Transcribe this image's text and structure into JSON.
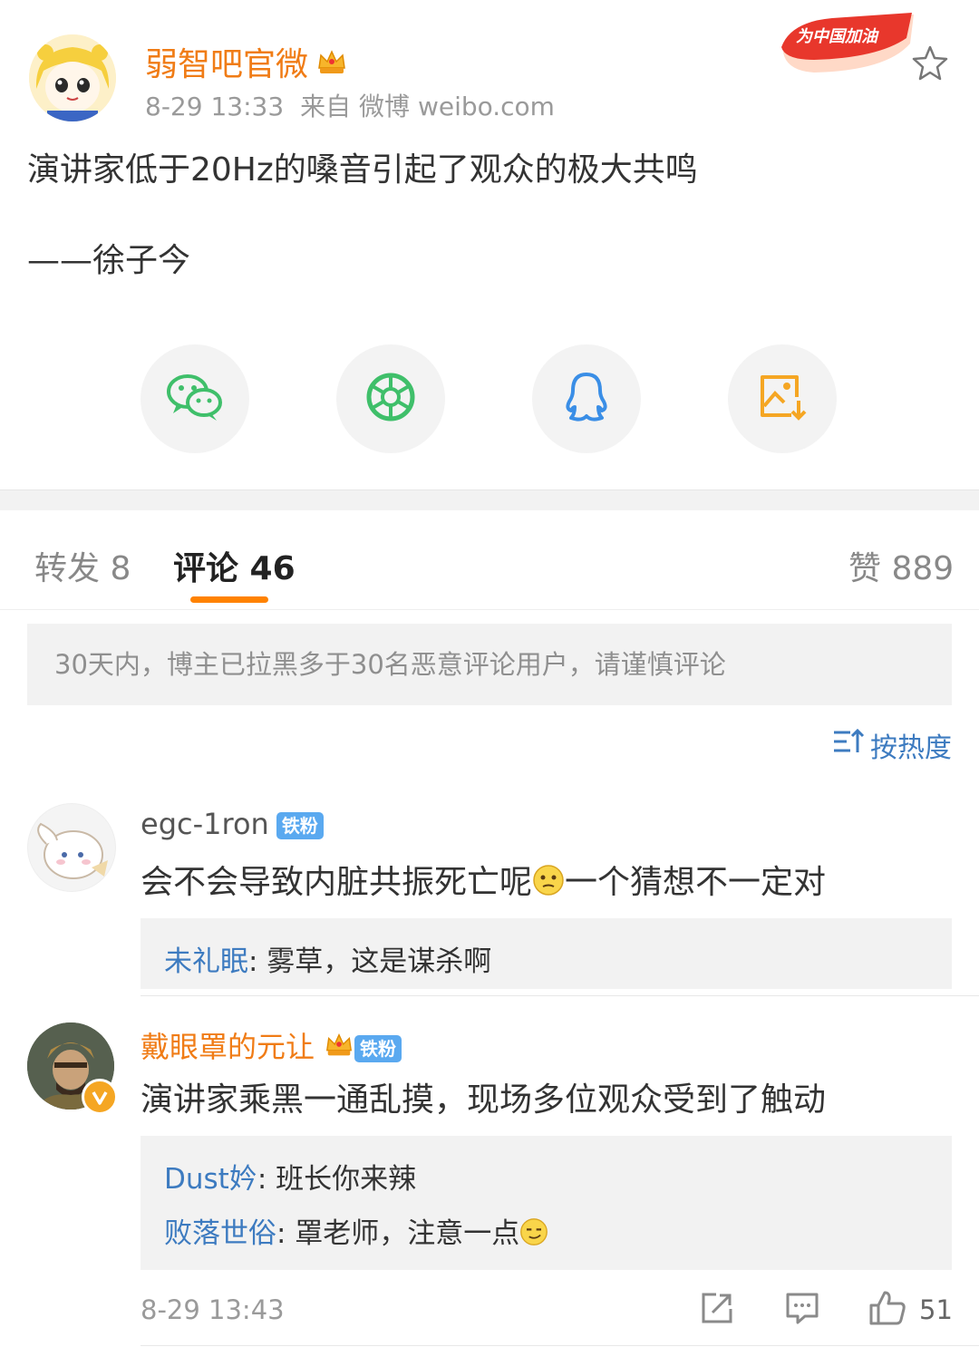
{
  "post": {
    "author": "弱智吧官微",
    "time": "8-29 13:33",
    "source": "来自 微博 weibo.com",
    "event_badge": "为中国加油",
    "text_line1": "演讲家低于20Hz的嗓音引起了观众的极大共鸣",
    "text_line2": "——徐子今"
  },
  "share": [
    {
      "icon": "wechat-icon"
    },
    {
      "icon": "moments-icon"
    },
    {
      "icon": "qq-icon"
    },
    {
      "icon": "save-image-icon"
    }
  ],
  "tabs": {
    "repost": "转发 8",
    "comments": "评论 46",
    "likes": "赞 889"
  },
  "notice": "30天内，博主已拉黑多于30名恶意评论用户，请谨慎评论",
  "sort_label": "按热度",
  "comments": [
    {
      "user": "egc-1ron",
      "badge": "铁粉",
      "text_a": "会不会导致内脏共振死亡呢",
      "text_b": "一个猜想不一定对",
      "replies": [
        {
          "user": "未礼眠",
          "text": ": 雾草，这是谋杀啊"
        }
      ]
    },
    {
      "user": "戴眼罩的元让",
      "badge": "铁粉",
      "text": "演讲家乘黑一通乱摸，现场多位观众受到了触动",
      "replies": [
        {
          "user": "Dust妗",
          "text": ": 班长你来辣"
        },
        {
          "user": "败落世俗",
          "text": ": 罩老师，注意一点"
        }
      ],
      "time": "8-29 13:43",
      "likes": "51"
    }
  ],
  "colors": {
    "accent": "#ff8200",
    "username_orange": "#f07c16",
    "link_blue": "#3d7bc0",
    "fan_badge": "#5aa9f0"
  }
}
